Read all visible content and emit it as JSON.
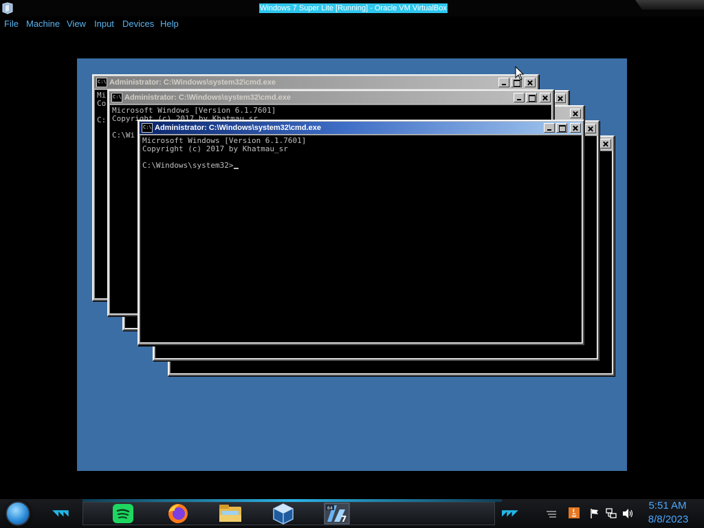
{
  "host": {
    "title": "Windows 7 Super Lite [Running] - Oracle VM VirtualBox",
    "menu": [
      "File",
      "Machine",
      "View",
      "Input",
      "Devices",
      "Help"
    ]
  },
  "guest": {
    "windows": [
      {
        "title": "Administrator: C:\\Windows\\system32\\cmd.exe",
        "lines": [
          "Mi",
          "Co",
          "",
          "C:"
        ]
      },
      {
        "title": "Administrator: C:\\Windows\\system32\\cmd.exe",
        "lines": [
          "Microsoft Windows [Version 6.1.7601]",
          "Copyright (c) 2017 by Khatmau_sr",
          "",
          "C:\\Wi"
        ]
      },
      {
        "title": "Administrator: C:\\Windows\\system32\\cmd.exe",
        "lines": [
          "Microsoft Windows [Version 6.1.7601]",
          "Copyright (c) 2017 by Khatmau_sr",
          "",
          "C:\\Windows\\system32>"
        ]
      }
    ]
  },
  "taskbar": {
    "items": [
      "start-orb",
      "spotify-icon",
      "firefox-icon",
      "file-explorer-icon",
      "virtualbox-icon",
      "windows7-vm-icon"
    ],
    "tray_icons": [
      "show-hidden-icon",
      "java-icon",
      "action-center-flag-icon",
      "network-icon",
      "volume-icon"
    ],
    "clock": {
      "time": "5:51 AM",
      "date": "8/8/2023"
    }
  },
  "colors": {
    "guest_desktop": "#3b6ea5",
    "active_title_start": "#0a246a",
    "active_title_end": "#a6caf0",
    "inactive_title": "#808080",
    "accent": "#2ab4e8",
    "clock": "#4aa8ff"
  }
}
